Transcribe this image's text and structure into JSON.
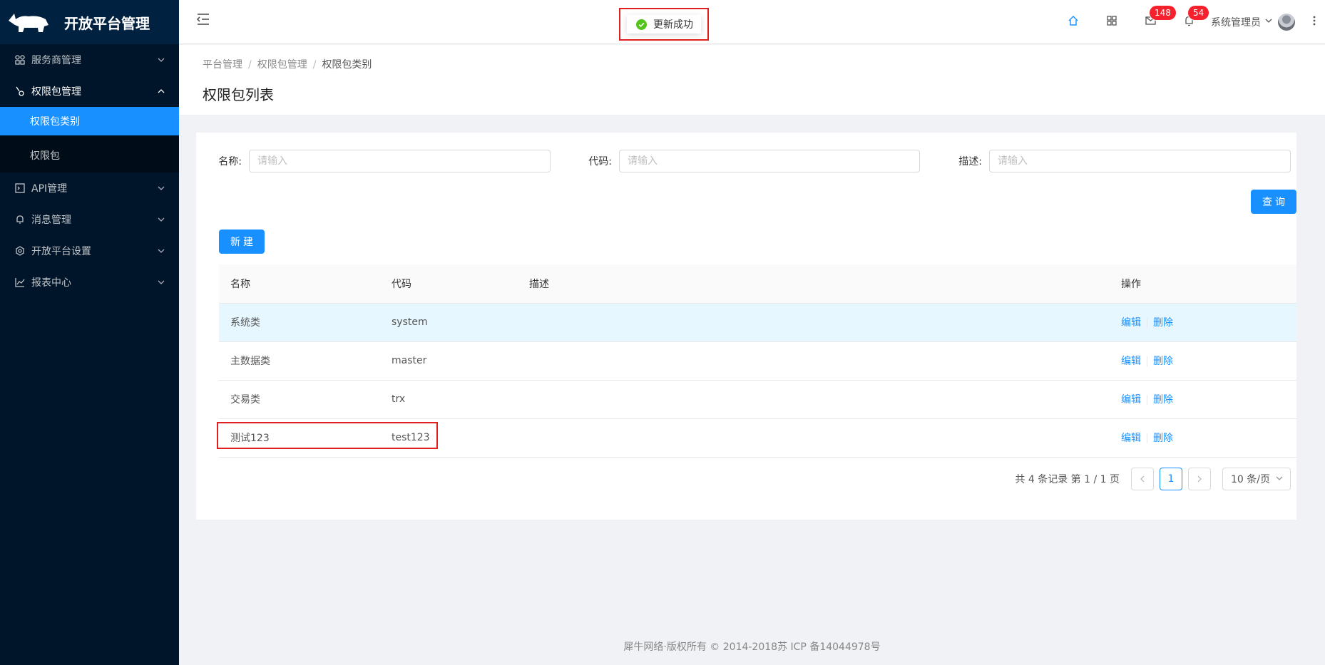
{
  "app": {
    "title": "开放平台管理"
  },
  "sidebar": {
    "items": [
      {
        "label": "服务商管理",
        "icon": "team-icon",
        "expanded": false
      },
      {
        "label": "权限包管理",
        "icon": "key-icon",
        "expanded": true,
        "children": [
          {
            "label": "权限包类别",
            "active": true
          },
          {
            "label": "权限包",
            "active": false
          }
        ]
      },
      {
        "label": "API管理",
        "icon": "api-icon",
        "expanded": false
      },
      {
        "label": "消息管理",
        "icon": "bell-icon",
        "expanded": false
      },
      {
        "label": "开放平台设置",
        "icon": "setting-icon",
        "expanded": false
      },
      {
        "label": "报表中心",
        "icon": "line-chart-icon",
        "expanded": false
      }
    ]
  },
  "header": {
    "toast_text": "更新成功",
    "mail_badge": "148",
    "notice_badge": "54",
    "user_name": "系统管理员"
  },
  "breadcrumb": [
    "平台管理",
    "权限包管理",
    "权限包类别"
  ],
  "page_title": "权限包列表",
  "form": {
    "name_label": "名称:",
    "code_label": "代码:",
    "desc_label": "描述:",
    "placeholder": "请输入",
    "search_label": "查询",
    "new_label": "新建"
  },
  "table": {
    "columns": [
      "名称",
      "代码",
      "描述",
      "操作"
    ],
    "rows": [
      {
        "name": "系统类",
        "code": "system",
        "desc": ""
      },
      {
        "name": "主数据类",
        "code": "master",
        "desc": ""
      },
      {
        "name": "交易类",
        "code": "trx",
        "desc": ""
      },
      {
        "name": "测试123",
        "code": "test123",
        "desc": ""
      }
    ],
    "edit_label": "编辑",
    "delete_label": "删除"
  },
  "pagination": {
    "total_text": "共 4 条记录 第 1 / 1 页",
    "current_page": "1",
    "page_size": "10 条/页"
  },
  "footer": "犀牛网络·版权所有 © 2014-2018苏 ICP 备14044978号",
  "colors": {
    "sidebar_bg": "#001529",
    "accent": "#1890ff",
    "highlight": "#e02020"
  }
}
